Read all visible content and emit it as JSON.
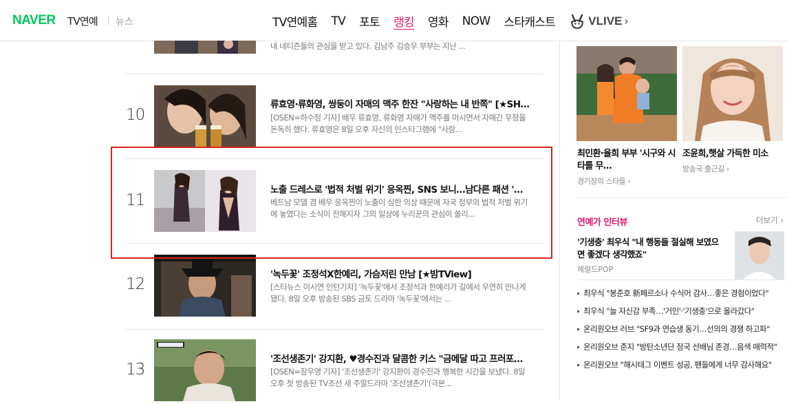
{
  "header": {
    "logo": "NAVER",
    "section": "TV연예",
    "sub": "뉴스",
    "nav": [
      {
        "label": "TV연예홈",
        "active": false
      },
      {
        "label": "TV",
        "active": false
      },
      {
        "label": "포토",
        "active": false
      },
      {
        "label": "랭킹",
        "active": true
      },
      {
        "label": "영화",
        "active": false
      },
      {
        "label": "NOW",
        "active": false
      },
      {
        "label": "스타캐스트",
        "active": false
      }
    ],
    "vlive": "VLIVE",
    "vlive_arrow": "›"
  },
  "ranking": {
    "prev_desc": "내 네티즌들의 관심을 받고 있다. 김남주 김승우 부부는 지난 ...",
    "items": [
      {
        "rank": "10",
        "title": "류효영·류화영, 쌍둥이 자매의 맥주 한잔 \"사랑하는 내 반쪽\" [★SHO…",
        "desc": "[OSEN=하수정 기자] 배우 류효영, 류화영 자매가 맥주를 마시면서 자매간 우정을 돈독히 했다. 류효영은 8일 오후 자신의 인스타그램에 \"사랑..."
      },
      {
        "rank": "11",
        "title": "노출 드레스로 '법적 처벌 위기' 응옥찐, SNS 보니…남다른 패션 '눈길'",
        "desc": "베트남 모델 겸 배우 응옥찐이 노출이 심한 의상 때문에 자국 정부의 법적 처벌 위기에 놓였다는 소식이 전해지자 그의 일상에 누리꾼의 관심이 쏠리..."
      },
      {
        "rank": "12",
        "title": "'녹두꽃' 조정석X한예리, 가슴저린 만남 [★밤TView]",
        "desc": "[스타뉴스 이시연 인턴기자] '녹두꽃'에서 조정석과 한예리가 길에서 우연히 만나게 됐다. 8일 오후 방송된 SBS 금토 드라마 '녹두꽃'에서는 ..."
      },
      {
        "rank": "13",
        "title": "'조선생존기' 강지환, ♥경수진과 달콤한 키스 \"금메달 따고 프러포즈…",
        "desc": "[OSEN=장우영 기자] '조선생존기' 강지환이 경수진과 행복한 시간을 보냈다. 8일 오후 첫 방송된 TV조선 새 주말드라마 '조선생존기'(극본..."
      }
    ]
  },
  "right": {
    "cards": [
      {
        "title": "최민환·율희 부부 '시구와 시타를 무…",
        "source": "경기장의 스타들 ›"
      },
      {
        "title": "조윤희,햇살 가득한 미소",
        "source": "방송국 출근길 ›"
      }
    ],
    "interview": {
      "heading": "연예가 인터뷰",
      "more": "더보기 ›",
      "title": "'기생충' 최우식 \"내 행동들 절실해 보였으면 좋겠다 생각했죠\"",
      "source": "헤럴드POP",
      "list": [
        "최우식 \"봉준호 新페르소나 수식어 감사…좋은 경험이었다\"",
        "최우식 \"늘 자신감 부족…'거인'·'기생충'으로 올라갔다\"",
        "온리원오브 러브 \"SF9과 연습생 동기…선의의 경쟁 하고파\"",
        "온리원오브 준지 \"방탄소년단 정국 선배님 존경…음색 매력적\"",
        "온리원오브 \"해시태그 이벤트 성공, 팬들에게 너무 감사해요\""
      ]
    }
  }
}
